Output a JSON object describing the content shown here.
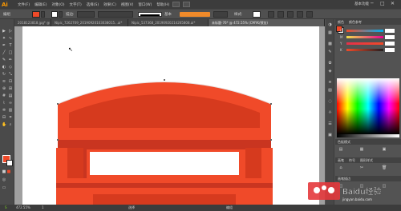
{
  "app": {
    "logo_text": "Ai",
    "menus": [
      "文件(F)",
      "编辑(E)",
      "对象(O)",
      "文字(T)",
      "选择(S)",
      "效果(C)",
      "视图(V)",
      "窗口(W)",
      "帮助(H)"
    ],
    "workspace": "基本功能",
    "win_controls": [
      "─",
      "□",
      "✕"
    ]
  },
  "controlbar": {
    "mode_label": "编组",
    "stroke_label": "描边:",
    "stroke_weight": "",
    "style_label": "等比",
    "brush_label": "基本",
    "opacity_label": "不透明度",
    "style2_label": "样式:"
  },
  "tabs": [
    {
      "label": "2018123818.jpg* @ 5..."
    },
    {
      "label": "Nipic_7262709_20190920103038015...ai*"
    },
    {
      "label": "Nipic_537368_20190920214265808.ai*"
    },
    {
      "label": "未标题-76* @ 472.55% (CMYK/预览)",
      "active": true
    }
  ],
  "panels": {
    "color_head": [
      "颜色",
      "颜色参考"
    ],
    "color_sliders": [
      {
        "label": "C",
        "value": "",
        "color": "#00aeef"
      },
      {
        "label": "M",
        "value": "",
        "color": "#ec008c"
      },
      {
        "label": "Y",
        "value": "",
        "color": "#fff200"
      },
      {
        "label": "K",
        "value": "",
        "color": "#231f20"
      }
    ],
    "swatches_head": [
      "色板模式",
      ""
    ],
    "brushes_head": [
      "画笔",
      "符号",
      "图形样式"
    ],
    "layers_head": [
      "画笔描边"
    ]
  },
  "status": {
    "zoom": "472.55%",
    "page": "1",
    "tool": "选择",
    "bottom_label": "编组"
  },
  "watermark": {
    "text": "Baidu经验",
    "sub": "jingyan.baidu.com"
  },
  "colors": {
    "booth_red": "#f04a29",
    "booth_dark": "#d63a1e",
    "booth_shadow": "#c93520"
  }
}
